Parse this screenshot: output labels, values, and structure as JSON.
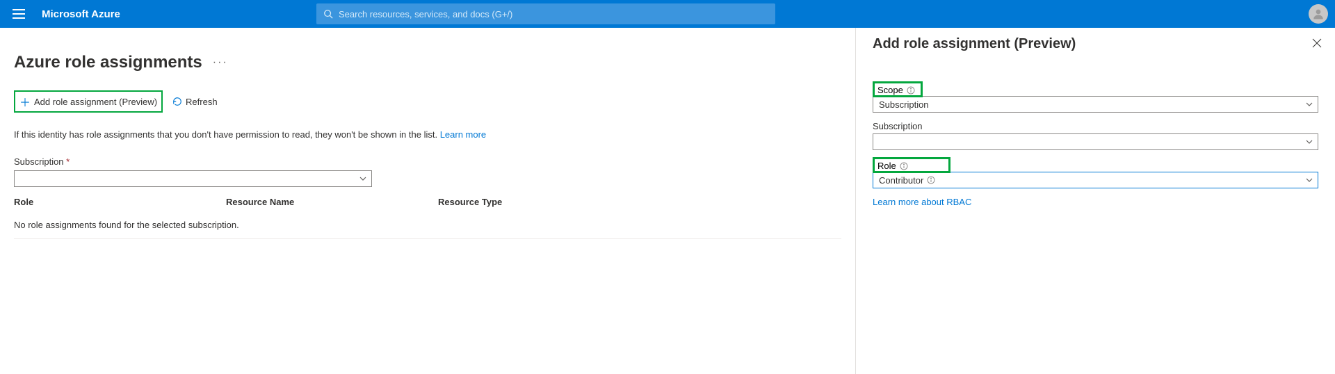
{
  "header": {
    "brand": "Microsoft Azure",
    "search_placeholder": "Search resources, services, and docs (G+/)"
  },
  "main": {
    "title": "Azure role assignments",
    "toolbar": {
      "add_role_label": "Add role assignment (Preview)",
      "refresh_label": "Refresh"
    },
    "info_text": "If this identity has role assignments that you don't have permission to read, they won't be shown in the list. ",
    "learn_more": "Learn more",
    "subscription_label": "Subscription",
    "table": {
      "col_role": "Role",
      "col_resource_name": "Resource Name",
      "col_resource_type": "Resource Type",
      "empty_message": "No role assignments found for the selected subscription."
    }
  },
  "panel": {
    "title": "Add role assignment (Preview)",
    "scope_label": "Scope",
    "scope_value": "Subscription",
    "subscription_label": "Subscription",
    "subscription_value": "",
    "role_label": "Role",
    "role_value": "Contributor",
    "rbac_link": "Learn more about RBAC"
  }
}
